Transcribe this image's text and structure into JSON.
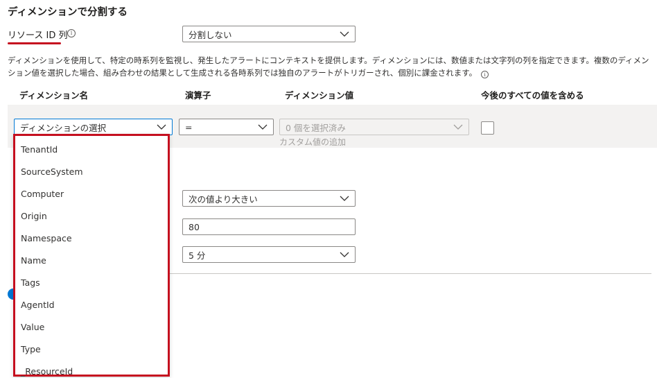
{
  "section": {
    "title": "ディメンションで分割する"
  },
  "resource_id": {
    "label": "リソース ID 列",
    "info_glyph": "i",
    "dropdown_value": "分割しない"
  },
  "description": "ディメンションを使用して、特定の時系列を監視し、発生したアラートにコンテキストを提供します。ディメンションには、数値または文字列の列を指定できます。複数のディメンション値を選択した場合、組み合わせの結果として生成される各時系列では独自のアラートがトリガーされ、個別に課金されます。",
  "columns": {
    "dimension_name": "ディメンション名",
    "operator": "演算子",
    "dimension_values": "ディメンション値",
    "include_future": "今後のすべての値を含める"
  },
  "row": {
    "dimension_select": "ディメンションの選択",
    "operator": "=",
    "values_placeholder": "0 個を選択済み",
    "custom_value_add": "カスタム値の追加"
  },
  "dropdown_items": [
    "TenantId",
    "SourceSystem",
    "Computer",
    "Origin",
    "Namespace",
    "Name",
    "Tags",
    "AgentId",
    "Value",
    "Type",
    "_ResourceId"
  ],
  "alert_logic": {
    "operator_value": "次の値より大きい",
    "threshold_value": "80",
    "granularity_value": "5 分"
  },
  "colors": {
    "highlight": "#c50f1f",
    "accent": "#0078d4"
  }
}
